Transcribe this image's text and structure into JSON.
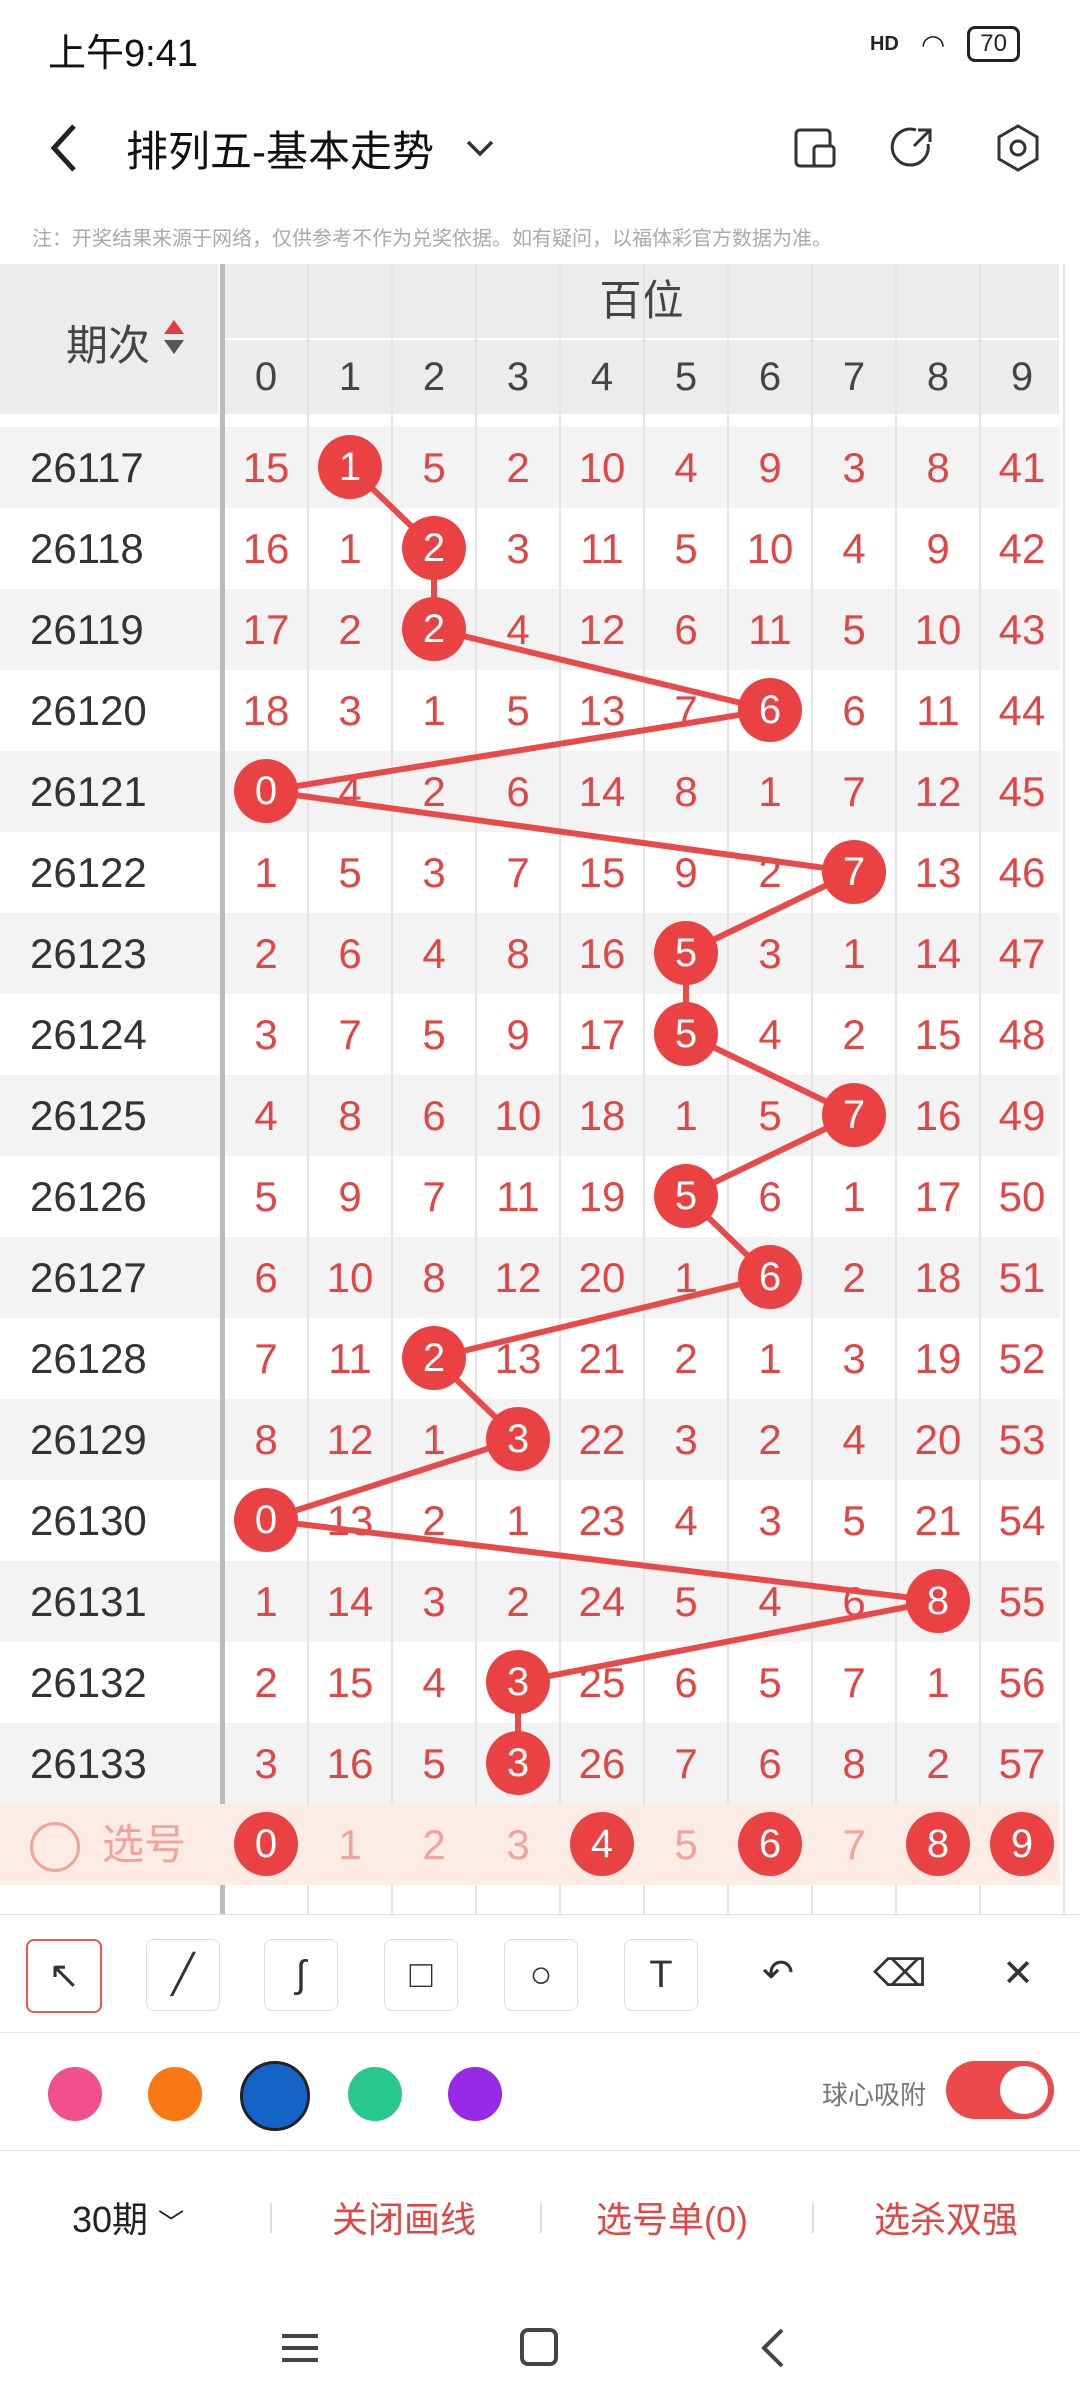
{
  "status": {
    "time": "上午9:41",
    "signal_label": "HD",
    "battery": "70"
  },
  "header": {
    "title": "排列五-基本走势"
  },
  "note": "注：开奖结果来源于网络，仅供参考不作为兑奖依据。如有疑问，以福体彩官方数据为准。",
  "table": {
    "period_header": "期次",
    "group_header": "百位",
    "digits": [
      "0",
      "1",
      "2",
      "3",
      "4",
      "5",
      "6",
      "7",
      "8",
      "9"
    ],
    "rows": [
      {
        "period": "26117",
        "cells": [
          "15",
          "1",
          "5",
          "2",
          "10",
          "4",
          "9",
          "3",
          "8",
          "41"
        ],
        "win": 1
      },
      {
        "period": "26118",
        "cells": [
          "16",
          "1",
          "2",
          "3",
          "11",
          "5",
          "10",
          "4",
          "9",
          "42"
        ],
        "win": 2
      },
      {
        "period": "26119",
        "cells": [
          "17",
          "2",
          "2",
          "4",
          "12",
          "6",
          "11",
          "5",
          "10",
          "43"
        ],
        "win": 2
      },
      {
        "period": "26120",
        "cells": [
          "18",
          "3",
          "1",
          "5",
          "13",
          "7",
          "6",
          "6",
          "11",
          "44"
        ],
        "win": 6
      },
      {
        "period": "26121",
        "cells": [
          "0",
          "4",
          "2",
          "6",
          "14",
          "8",
          "1",
          "7",
          "12",
          "45"
        ],
        "win": 0
      },
      {
        "period": "26122",
        "cells": [
          "1",
          "5",
          "3",
          "7",
          "15",
          "9",
          "2",
          "7",
          "13",
          "46"
        ],
        "win": 7
      },
      {
        "period": "26123",
        "cells": [
          "2",
          "6",
          "4",
          "8",
          "16",
          "5",
          "3",
          "1",
          "14",
          "47"
        ],
        "win": 5
      },
      {
        "period": "26124",
        "cells": [
          "3",
          "7",
          "5",
          "9",
          "17",
          "5",
          "4",
          "2",
          "15",
          "48"
        ],
        "win": 5
      },
      {
        "period": "26125",
        "cells": [
          "4",
          "8",
          "6",
          "10",
          "18",
          "1",
          "5",
          "7",
          "16",
          "49"
        ],
        "win": 7
      },
      {
        "period": "26126",
        "cells": [
          "5",
          "9",
          "7",
          "11",
          "19",
          "5",
          "6",
          "1",
          "17",
          "50"
        ],
        "win": 5
      },
      {
        "period": "26127",
        "cells": [
          "6",
          "10",
          "8",
          "12",
          "20",
          "1",
          "6",
          "2",
          "18",
          "51"
        ],
        "win": 6
      },
      {
        "period": "26128",
        "cells": [
          "7",
          "11",
          "2",
          "13",
          "21",
          "2",
          "1",
          "3",
          "19",
          "52"
        ],
        "win": 2
      },
      {
        "period": "26129",
        "cells": [
          "8",
          "12",
          "1",
          "3",
          "22",
          "3",
          "2",
          "4",
          "20",
          "53"
        ],
        "win": 3
      },
      {
        "period": "26130",
        "cells": [
          "0",
          "13",
          "2",
          "1",
          "23",
          "4",
          "3",
          "5",
          "21",
          "54"
        ],
        "win": 0
      },
      {
        "period": "26131",
        "cells": [
          "1",
          "14",
          "3",
          "2",
          "24",
          "5",
          "4",
          "6",
          "8",
          "55"
        ],
        "win": 8
      },
      {
        "period": "26132",
        "cells": [
          "2",
          "15",
          "4",
          "3",
          "25",
          "6",
          "5",
          "7",
          "1",
          "56"
        ],
        "win": 3
      },
      {
        "period": "26133",
        "cells": [
          "3",
          "16",
          "5",
          "3",
          "26",
          "7",
          "6",
          "8",
          "2",
          "57"
        ],
        "win": 3
      }
    ],
    "select_label": "选号",
    "select_nums": [
      "0",
      "1",
      "2",
      "3",
      "4",
      "5",
      "6",
      "7",
      "8",
      "9"
    ],
    "select_active": [
      0,
      4,
      6,
      8,
      9
    ]
  },
  "tools": [
    "pointer-tool",
    "line-tool",
    "curve-tool",
    "rect-tool",
    "circle-tool",
    "text-tool",
    "undo-tool",
    "eraser-tool",
    "clear-tool"
  ],
  "palette": {
    "colors": [
      "#f0508c",
      "#fa7814",
      "#1464c8",
      "#28c88c",
      "#9628e6"
    ],
    "snap_label": "球心吸附"
  },
  "bottom": {
    "periods": "30期",
    "close_lines": "关闭画线",
    "selection": "选号单(0)",
    "kill": "选杀双强"
  }
}
